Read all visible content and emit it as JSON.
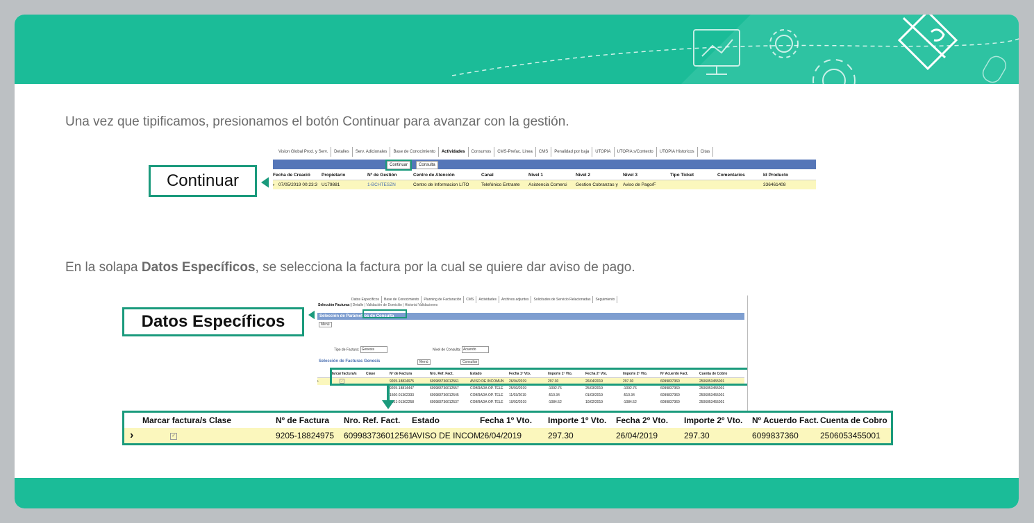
{
  "paragraph1": "Una vez que tipificamos, presionamos el botón Continuar para avanzar con la gestión.",
  "paragraph2": {
    "before": "En la solapa ",
    "bold": "Datos Específicos",
    "after": ", se selecciona la factura por la cual se quiere dar aviso de pago."
  },
  "callout1": "Continuar",
  "callout2": "Datos Específicos",
  "screenshot1": {
    "tabs": [
      "Vision Global Prod. y Serv.",
      "Detalles",
      "Serv. Adicionales",
      "Base de Conocimiento",
      "Actividades",
      "Consumos",
      "CMS-Prefac. Linea",
      "CMS",
      "Penalidad por baja",
      "UTOPIA",
      "UTOPIA s/Contexto",
      "UTOPIA Historicos",
      "Citas"
    ],
    "active_tab": "Actividades",
    "buttons": [
      "Continuar",
      "Consulta"
    ],
    "columns": [
      "Fecha de Creació",
      "Propietario",
      "Nº de Gestión",
      "Centro de Atención",
      "Canal",
      "Nivel 1",
      "Nivel 2",
      "Nivel 3",
      "Tipo Ticket",
      "Comentarios",
      "Id Producto"
    ],
    "row": [
      "07/05/2019 00:23:3",
      "U179881",
      "1-BCHTESZN",
      "Centro de Informacion LITO",
      "Telefónico Entrante",
      "Asistencia Comerci",
      "Gestion Cobranzas y",
      "Aviso de Pago/F",
      "",
      "",
      "336461408"
    ]
  },
  "screenshot2": {
    "tabs": [
      "Datos Específicos",
      "Base de Conocimiento",
      "Planning de Facturación",
      "CMS",
      "Actividades",
      "Archivos adjuntos",
      "Solicitudes de Servicio Relacionadas",
      "Seguimiento"
    ],
    "subtabs": [
      "Selección Facturas",
      "Detalle",
      "Validación de Domicilio",
      "Historial Validaciones"
    ],
    "section1": "Selección de Parámetros de Consulta",
    "menu": "Menú",
    "tipo_label": "Tipo de Factura:",
    "tipo_value": "Genesis",
    "nivel_label": "Nivel de Consulta:",
    "nivel_value": "Acuerdo",
    "section2": "Selección de Facturas Genesis",
    "consultar": "Consultar",
    "columns": [
      "Marcar factura/s",
      "Clase",
      "Nº de Factura",
      "Nro. Ref. Fact.",
      "Estado",
      "Fecha 1º Vto.",
      "Importe 1º Vto.",
      "Fecha 2º Vto.",
      "Importe 2º Vto.",
      "Nº Acuerdo Fact.",
      "Cuenta de Cobro"
    ],
    "rows": [
      [
        "",
        "",
        "9205-18824975",
        "609983736012561",
        "AVISO DE INCOMUN",
        "26/04/2019",
        "297.30",
        "26/04/2019",
        "297.30",
        "6099837360",
        "2506053455001"
      ],
      [
        "",
        "",
        "9205-18814447",
        "609983736012557",
        "COBRADA OP. TELE",
        "25/03/2019",
        "-1092.76",
        "25/03/2019",
        "-1092.76",
        "6099837360",
        "2506053455001"
      ],
      [
        "",
        "",
        "1500-01362333",
        "609983736012545",
        "COBRADA OP. TELE",
        "11/03/2019",
        "-510.34",
        "01/03/2019",
        "-510.34",
        "6099837360",
        "2506053455001"
      ],
      [
        "",
        "",
        "1501-01362258",
        "609983736012537",
        "COBRADA OP. TELE",
        "10/02/2019",
        "-1084.52",
        "10/02/2019",
        "-1084.52",
        "6099837360",
        "2506053455001"
      ]
    ]
  },
  "zoom": {
    "columns": [
      "Marcar factura/s",
      "Clase",
      "Nº de Factura",
      "Nro. Ref. Fact.",
      "Estado",
      "Fecha 1º Vto.",
      "Importe 1º Vto.",
      "Fecha 2º Vto.",
      "Importe 2º Vto.",
      "Nº Acuerdo Fact.",
      "Cuenta de Cobro"
    ],
    "row": [
      "",
      "",
      "9205-18824975",
      "609983736012561",
      "AVISO DE INCOMUN",
      "26/04/2019",
      "297.30",
      "26/04/2019",
      "297.30",
      "6099837360",
      "2506053455001"
    ]
  },
  "colors": {
    "accent": "#1bbc98",
    "border": "#1a9a7c",
    "highlight_row": "#fbf7bd"
  }
}
